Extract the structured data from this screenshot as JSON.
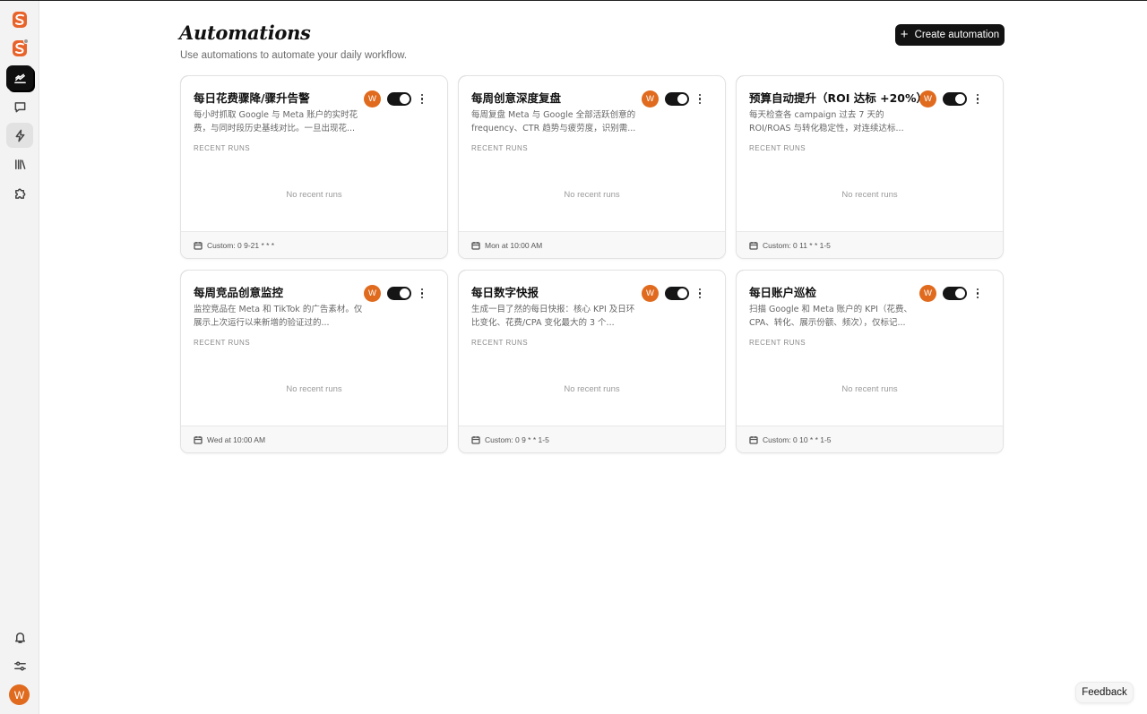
{
  "app": {
    "brand_color": "#e06a1d"
  },
  "sidebar": {
    "items": [
      {
        "name": "overview",
        "icon": "chart-trend-icon",
        "active": false
      },
      {
        "name": "chat",
        "icon": "chat-bubble-icon",
        "active": false
      },
      {
        "name": "automations",
        "icon": "lightning-icon",
        "active": true
      },
      {
        "name": "library",
        "icon": "library-icon",
        "active": false
      },
      {
        "name": "integrations",
        "icon": "puzzle-icon",
        "active": false
      }
    ],
    "bottom": [
      {
        "name": "notifications",
        "icon": "bell-icon"
      },
      {
        "name": "settings",
        "icon": "sliders-icon"
      }
    ],
    "avatar_initial": "W"
  },
  "header": {
    "title": "Automations",
    "subtitle": "Use automations to automate your daily workflow.",
    "create_label": "Create automation"
  },
  "cards": [
    {
      "title": "每日花费骤降/骤升告警",
      "description": "每小时抓取 Google 与 Meta 账户的实时花费，与同时段历史基线对比。一旦出现花...",
      "avatar": "W",
      "enabled": true,
      "runs_label": "RECENT RUNS",
      "empty_text": "No recent runs",
      "schedule": "Custom: 0 9-21 * * *"
    },
    {
      "title": "每周创意深度复盘",
      "description": "每周复盘 Meta 与 Google 全部活跃创意的 frequency、CTR 趋势与疲劳度，识别需...",
      "avatar": "W",
      "enabled": true,
      "runs_label": "RECENT RUNS",
      "empty_text": "No recent runs",
      "schedule": "Mon at 10:00 AM"
    },
    {
      "title": "预算自动提升（ROI 达标 +20%）",
      "description": "每天检查各 campaign 过去 7 天的 ROI/ROAS 与转化稳定性，对连续达标...",
      "avatar": "W",
      "enabled": true,
      "runs_label": "RECENT RUNS",
      "empty_text": "No recent runs",
      "schedule": "Custom: 0 11 * * 1-5"
    },
    {
      "title": "每周竞品创意监控",
      "description": "监控竞品在 Meta 和 TikTok 的广告素材。仅展示上次运行以来新增的验证过的...",
      "avatar": "W",
      "enabled": true,
      "runs_label": "RECENT RUNS",
      "empty_text": "No recent runs",
      "schedule": "Wed at 10:00 AM"
    },
    {
      "title": "每日数字快报",
      "description": "生成一目了然的每日快报：核心 KPI 及日环比变化、花费/CPA 变化最大的 3 个...",
      "avatar": "W",
      "enabled": true,
      "runs_label": "RECENT RUNS",
      "empty_text": "No recent runs",
      "schedule": "Custom: 0 9 * * 1-5"
    },
    {
      "title": "每日账户巡检",
      "description": "扫描 Google 和 Meta 账户的 KPI（花费、CPA、转化、展示份额、频次），仅标记...",
      "avatar": "W",
      "enabled": true,
      "runs_label": "RECENT RUNS",
      "empty_text": "No recent runs",
      "schedule": "Custom: 0 10 * * 1-5"
    }
  ],
  "feedback_label": "Feedback"
}
